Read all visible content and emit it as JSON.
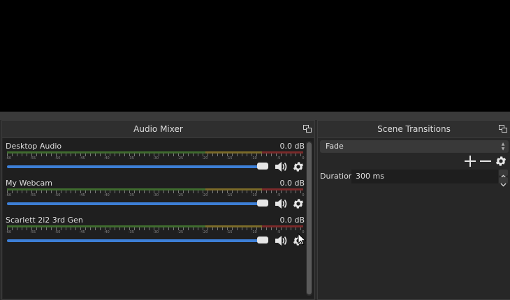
{
  "mixer": {
    "title": "Audio Mixer",
    "tick_labels": [
      "-60",
      "-55",
      "-50",
      "-45",
      "-40",
      "-35",
      "-30",
      "-25",
      "-20",
      "-15",
      "-10",
      "-5",
      "0"
    ],
    "channels": [
      {
        "name": "Desktop Audio",
        "db": "0.0 dB",
        "volume_level": 1.0
      },
      {
        "name": "My Webcam",
        "db": "0.0 dB",
        "volume_level": 1.0
      },
      {
        "name": "Scarlett 2i2 3rd Gen",
        "db": "0.0 dB",
        "volume_level": 1.0
      }
    ]
  },
  "transitions": {
    "title": "Scene Transitions",
    "selected": "Fade",
    "duration_label": "Duration",
    "duration_value": "300 ms"
  },
  "colors": {
    "preview": "#000000",
    "slider": "#3d7fd6",
    "meter_green": "#3f6b2e",
    "meter_yellow": "#7a6a28",
    "meter_red": "#7a2a2a"
  },
  "icons": [
    "undock-icon",
    "speaker-icon",
    "gear-icon",
    "plus-icon",
    "minus-icon",
    "spin-up-icon",
    "spin-down-icon",
    "cursor-icon"
  ]
}
